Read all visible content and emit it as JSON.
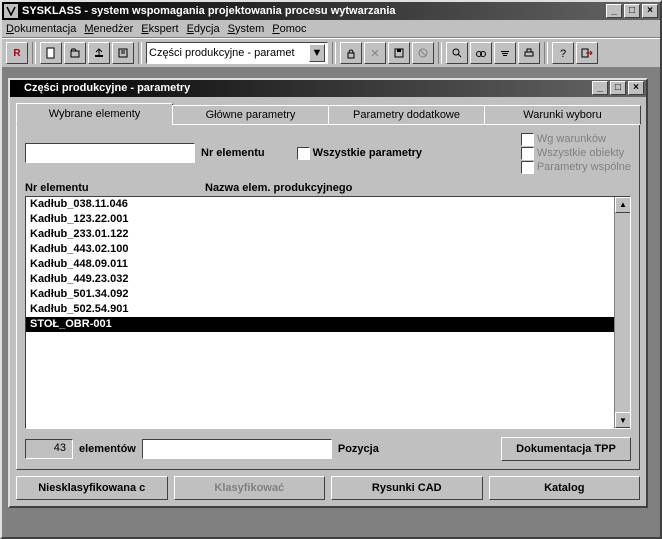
{
  "app": {
    "title": "SYSKLASS - system  wspomagania projektowania procesu wytwarzania"
  },
  "menu": {
    "items": [
      "Dokumentacja",
      "Menedżer",
      "Ekspert",
      "Edycja",
      "System",
      "Pomoc"
    ]
  },
  "toolbar": {
    "r_label": "R",
    "combo_value": "Części produkcyjne - paramet"
  },
  "inner": {
    "title": "Części produkcyjne - parametry",
    "tabs": [
      {
        "label": "Wybrane elementy"
      },
      {
        "label": "Główne parametry"
      },
      {
        "label": "Parametry dodatkowe"
      },
      {
        "label": "Warunki wyboru"
      }
    ],
    "nr_elementu_label": "Nr elementu",
    "nr_elementu_value": "",
    "all_params_label": "Wszystkie parametry",
    "wg_warunkow_label": "Wg warunków",
    "wszystkie_obiekty_label": "Wszystkie obiekty",
    "parametry_wspolne_label": "Parametry wspólne",
    "col_nr": "Nr elementu",
    "col_nazwa": "Nazwa elem. produkcyjnego",
    "list": [
      "Kadłub_038.11.046",
      "Kadłub_123.22.001",
      "Kadłub_233.01.122",
      "Kadłub_443.02.100",
      "Kadłub_448.09.011",
      "Kadłub_449.23.032",
      "Kadłub_501.34.092",
      "Kadłub_502.54.901",
      "STOŁ_OBR-001"
    ],
    "selected_index": 8,
    "count_value": "43",
    "count_label": "elementów",
    "pozycja_label": "Pozycja",
    "pozycja_value": "",
    "btn_dokumentacja": "Dokumentacja TPP",
    "btn_niesklasyfikowana": "Niesklasyfikowana c",
    "btn_klasyfikowac": "Klasyfikować",
    "btn_rysunki": "Rysunki CAD",
    "btn_katalog": "Katalog"
  }
}
